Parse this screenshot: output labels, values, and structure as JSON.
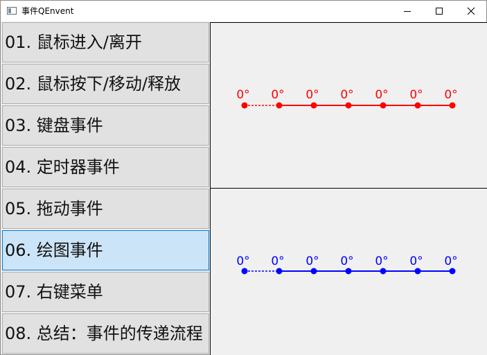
{
  "window": {
    "title": "事件QEnvent"
  },
  "nav": {
    "items": [
      {
        "label": "01. 鼠标进入/离开",
        "selected": false
      },
      {
        "label": "02. 鼠标按下/移动/释放",
        "selected": false
      },
      {
        "label": "03. 键盘事件",
        "selected": false
      },
      {
        "label": "04. 定时器事件",
        "selected": false
      },
      {
        "label": "05. 拖动事件",
        "selected": false
      },
      {
        "label": "06. 绘图事件",
        "selected": true
      },
      {
        "label": "07. 右键菜单",
        "selected": false
      },
      {
        "label": "08. 总结：事件的传递流程",
        "selected": false
      }
    ]
  },
  "chains": {
    "top": {
      "color": "#ff0000",
      "angles": [
        "0°",
        "0°",
        "0°",
        "0°",
        "0°",
        "0°",
        "0°"
      ]
    },
    "bottom": {
      "color": "#0000ff",
      "angles": [
        "0°",
        "0°",
        "0°",
        "0°",
        "0°",
        "0°",
        "0°"
      ]
    }
  }
}
